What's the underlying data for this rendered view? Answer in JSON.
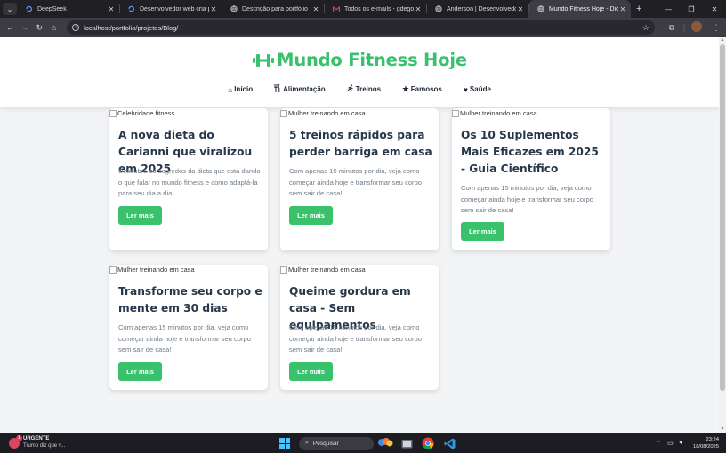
{
  "browser": {
    "tabs": [
      {
        "title": "DeepSeek",
        "icon": "deepseek-icon",
        "active": false
      },
      {
        "title": "Desenvolvedor web cria portfólio",
        "icon": "deepseek-icon",
        "active": false
      },
      {
        "title": "Descrição para portfólio",
        "icon": "globe-icon",
        "active": false
      },
      {
        "title": "Todos os e-mails - gdegobl...",
        "icon": "gmail-icon",
        "active": false
      },
      {
        "title": "Anderson | Desenvolvedor Fron",
        "icon": "globe-icon",
        "active": false
      },
      {
        "title": "Mundo Fitness Hoje - Dicas de",
        "icon": "globe-icon",
        "active": true
      }
    ],
    "url": "localhost/portfolio/projetos/Blog/"
  },
  "site": {
    "brand": "Mundo Fitness Hoje",
    "brand_color": "#3ac16c",
    "nav": [
      {
        "label": "Início",
        "icon": "home-icon"
      },
      {
        "label": "Alimentação",
        "icon": "utensils-icon"
      },
      {
        "label": "Treinos",
        "icon": "running-icon"
      },
      {
        "label": "Famosos",
        "icon": "star-icon"
      },
      {
        "label": "Saúde",
        "icon": "heart-pulse-icon"
      }
    ]
  },
  "posts": [
    {
      "image_alt": "Celebridade fitness",
      "title": "A nova dieta do Carianni que viralizou em 2025",
      "excerpt": "Descubra os segredos da dieta que está dando o que falar no mundo fitness e como adaptá-la para seu dia a dia.",
      "button": "Ler mais"
    },
    {
      "image_alt": "Mulher treinando em casa",
      "title": "5 treinos rápidos para perder barriga em casa",
      "excerpt": "Com apenas 15 minutos por dia, veja como começar ainda hoje e transformar seu corpo sem sair de casa!",
      "button": "Ler mais"
    },
    {
      "image_alt": "Mulher treinando em casa",
      "title": "Os 10 Suplementos Mais Eficazes em 2025 - Guia Científico",
      "excerpt": "Com apenas 15 minutos por dia, veja como começar ainda hoje e transformar seu corpo sem sair de casa!",
      "button": "Ler mais"
    },
    {
      "image_alt": "Mulher treinando em casa",
      "title": "Transforme seu corpo e mente em 30 dias",
      "excerpt": "Com apenas 15 minutos por dia, veja como começar ainda hoje e transformar seu corpo sem sair de casa!",
      "button": "Ler mais"
    },
    {
      "image_alt": "Mulher treinando em casa",
      "title": "Queime gordura em casa - Sem equipamentos",
      "excerpt": "Com apenas 15 minutos por dia, veja como começar ainda hoje e transformar seu corpo sem sair de casa!",
      "button": "Ler mais"
    }
  ],
  "taskbar": {
    "news_badge": "URGENTE",
    "news_text": "Trump diz que v...",
    "search_placeholder": "Pesquisar",
    "time": "23:24",
    "date": "18/08/2025"
  }
}
